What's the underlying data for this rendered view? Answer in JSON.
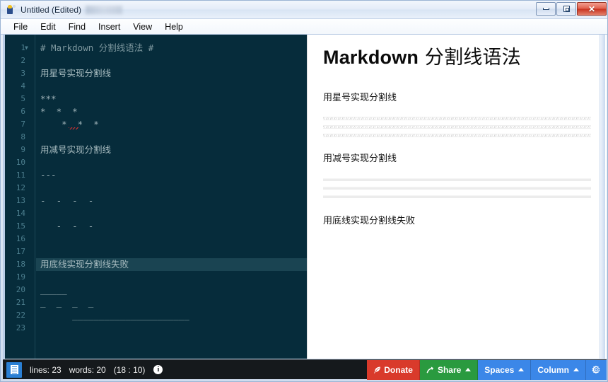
{
  "window": {
    "title": "Untitled (Edited)",
    "icon": "app-icon",
    "buttons": {
      "minimize": "minimize",
      "maximize": "maximize",
      "close": "✕"
    }
  },
  "menubar": {
    "items": [
      {
        "label": "File"
      },
      {
        "label": "Edit"
      },
      {
        "label": "Find"
      },
      {
        "label": "Insert"
      },
      {
        "label": "View"
      },
      {
        "label": "Help"
      }
    ]
  },
  "editor": {
    "current_line": 18,
    "lines": [
      {
        "n": 1,
        "text": "# Markdown 分割线语法 #",
        "kind": "heading",
        "fold": "▼"
      },
      {
        "n": 2,
        "text": ""
      },
      {
        "n": 3,
        "text": "用星号实现分割线",
        "kind": "cjk"
      },
      {
        "n": 4,
        "text": ""
      },
      {
        "n": 5,
        "text": "***"
      },
      {
        "n": 6,
        "text": "*  *  *"
      },
      {
        "n": 7,
        "text": "    *  *  *"
      },
      {
        "n": 8,
        "text": ""
      },
      {
        "n": 9,
        "text": "用减号实现分割线",
        "kind": "cjk"
      },
      {
        "n": 10,
        "text": ""
      },
      {
        "n": 11,
        "text": "---"
      },
      {
        "n": 12,
        "text": ""
      },
      {
        "n": 13,
        "text": "-  -  -  -"
      },
      {
        "n": 14,
        "text": ""
      },
      {
        "n": 15,
        "text": "   -  -  -"
      },
      {
        "n": 16,
        "text": ""
      },
      {
        "n": 17,
        "text": ""
      },
      {
        "n": 18,
        "text": "用底线实现分割线失败",
        "kind": "cjk"
      },
      {
        "n": 19,
        "text": ""
      },
      {
        "n": 20,
        "text": "_____"
      },
      {
        "n": 21,
        "text": "_  _  _  _"
      },
      {
        "n": 22,
        "text": "      ______________________"
      },
      {
        "n": 23,
        "text": ""
      }
    ]
  },
  "preview": {
    "heading_en": "Markdown",
    "heading_cjk": " 分割线语法",
    "para_star": "用星号实现分割线",
    "para_dash": "用减号实现分割线",
    "para_underscore": "用底线实现分割线失败",
    "hr_star_count": 3,
    "hr_dash_count": 3
  },
  "statusbar": {
    "doc_icon": "document-icon",
    "lines_label": "lines: 23",
    "words_label": "words: 20",
    "position_label": "(18 : 10)",
    "info_icon": "i",
    "buttons": [
      {
        "label": "Donate",
        "icon": "feather-icon",
        "color": "#d93a2b"
      },
      {
        "label": "Share",
        "icon": "share-arrow-icon",
        "color": "#2a9a3f",
        "caret": true
      },
      {
        "label": "Spaces",
        "color": "#3b87e8",
        "caret": true
      },
      {
        "label": "Column",
        "color": "#3b87e8",
        "caret": true
      },
      {
        "label": "",
        "icon": "gear-icon",
        "color": "#3b87e8"
      }
    ]
  },
  "colors": {
    "editor_bg": "#062c3b",
    "editor_text": "#9fb3b8",
    "current_line_bg": "#1a4452",
    "gutter_text": "#4d7f8f",
    "statusbar_bg": "#15191c"
  }
}
